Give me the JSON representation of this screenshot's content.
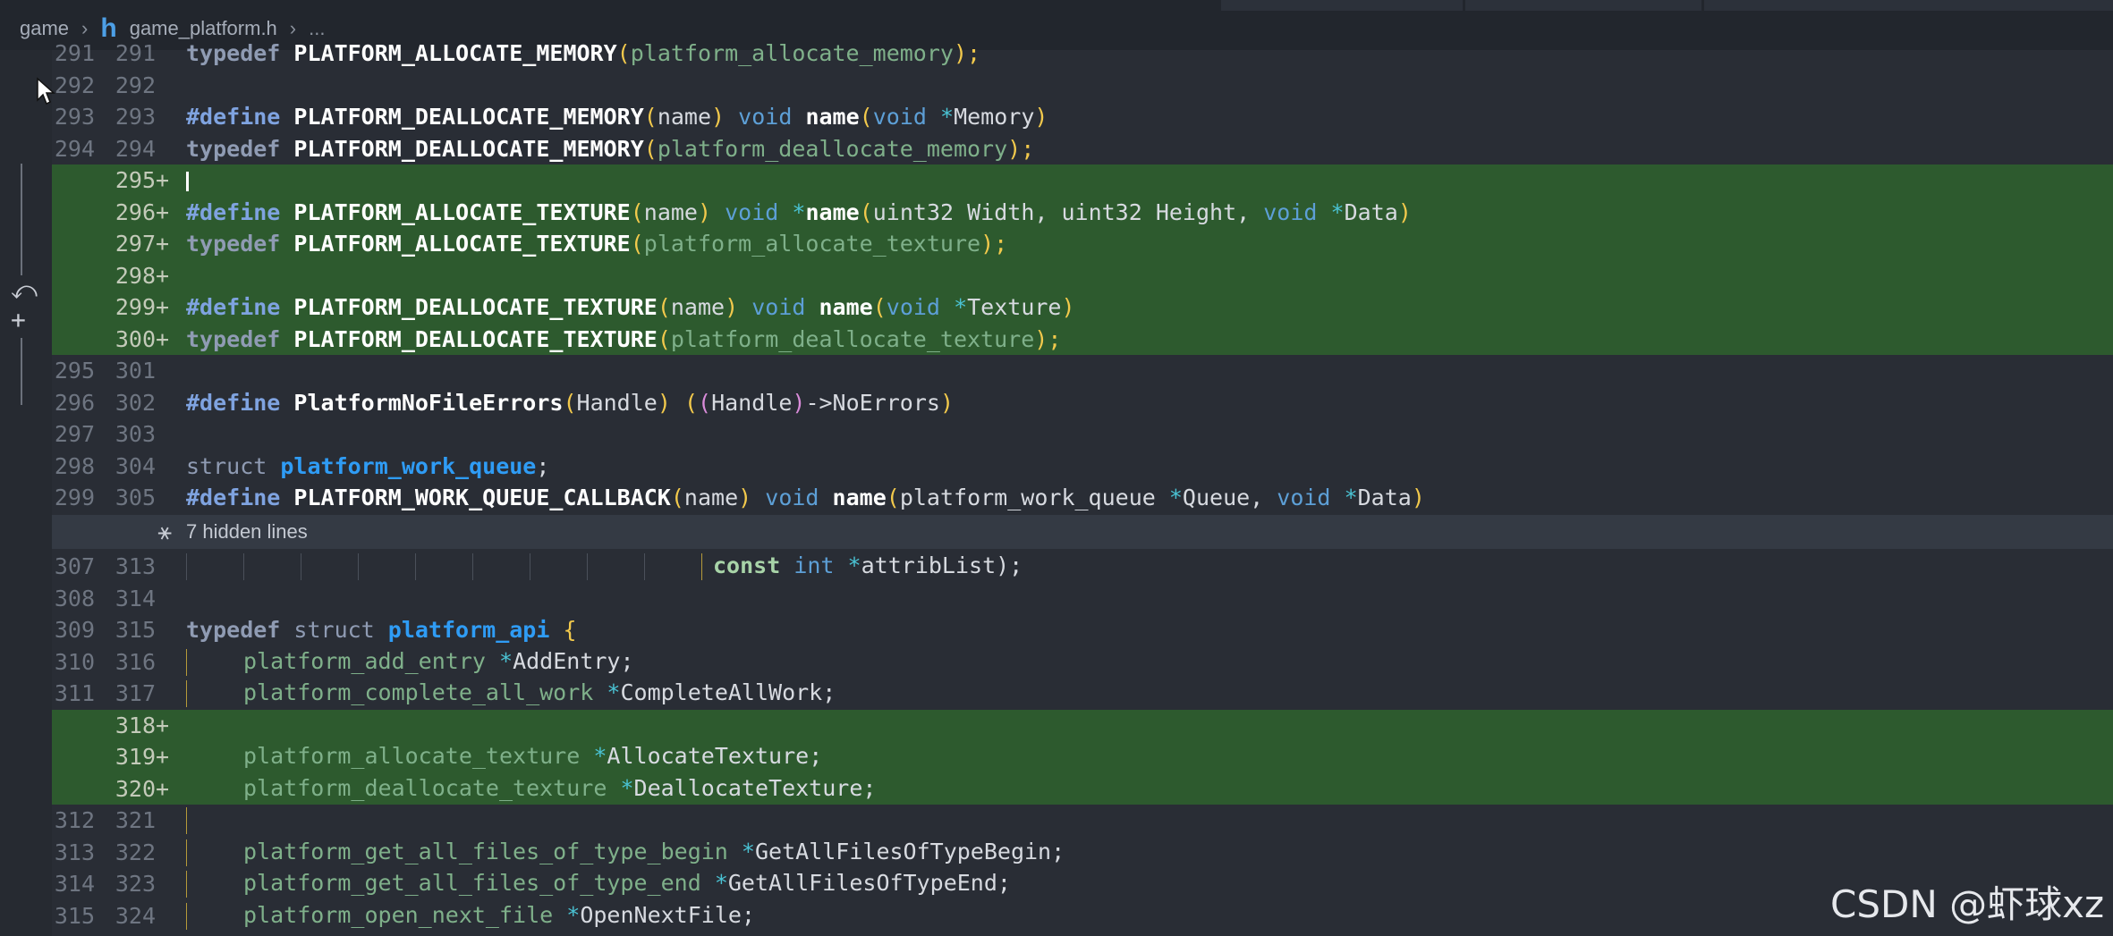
{
  "breadcrumb": {
    "folder": "game",
    "file_icon": "h",
    "file": "game_platform.h",
    "tail": "..."
  },
  "fold": {
    "text": "7 hidden lines"
  },
  "lines": {
    "l291": {
      "old": "291",
      "new": "291",
      "t1": "typedef",
      "t2": "PLATFORM_ALLOCATE_MEMORY",
      "t3": "(",
      "t4": "platform_allocate_memory",
      "t5": ");"
    },
    "l292": {
      "old": "292",
      "new": "292"
    },
    "l293": {
      "old": "293",
      "new": "293",
      "t1": "#define",
      "t2": "PLATFORM_DEALLOCATE_MEMORY",
      "t3": "(",
      "t4": "name",
      "t5": ")",
      "t6": "void",
      "t7": "name",
      "t8": "(",
      "t9": "void",
      "t10": "*",
      "t11": "Memory",
      "t12": ")"
    },
    "l294": {
      "old": "294",
      "new": "294",
      "t1": "typedef",
      "t2": "PLATFORM_DEALLOCATE_MEMORY",
      "t3": "(",
      "t4": "platform_deallocate_memory",
      "t5": ");"
    },
    "a295": {
      "new": "295",
      "mark": "+"
    },
    "a296": {
      "new": "296",
      "mark": "+",
      "t1": "#define",
      "t2": "PLATFORM_ALLOCATE_TEXTURE",
      "t3": "(",
      "t4": "name",
      "t5": ")",
      "t6": "void",
      "t7": "*",
      "t8": "name",
      "t9": "(",
      "t10": "uint32 Width, uint32 Height, ",
      "t11": "void",
      "t12": "*",
      "t13": "Data",
      "t14": ")"
    },
    "a297": {
      "new": "297",
      "mark": "+",
      "t1": "typedef",
      "t2": "PLATFORM_ALLOCATE_TEXTURE",
      "t3": "(",
      "t4": "platform_allocate_texture",
      "t5": ");"
    },
    "a298": {
      "new": "298",
      "mark": "+"
    },
    "a299": {
      "new": "299",
      "mark": "+",
      "t1": "#define",
      "t2": "PLATFORM_DEALLOCATE_TEXTURE",
      "t3": "(",
      "t4": "name",
      "t5": ")",
      "t6": "void",
      "t7": "name",
      "t8": "(",
      "t9": "void",
      "t10": "*",
      "t11": "Texture",
      "t12": ")"
    },
    "a300": {
      "new": "300",
      "mark": "+",
      "t1": "typedef",
      "t2": "PLATFORM_DEALLOCATE_TEXTURE",
      "t3": "(",
      "t4": "platform_deallocate_texture",
      "t5": ");"
    },
    "l301": {
      "old": "295",
      "new": "301"
    },
    "l302": {
      "old": "296",
      "new": "302",
      "t1": "#define",
      "t2": "PlatformNoFileErrors",
      "t3": "(",
      "t4": "Handle",
      "t5": ")",
      "t6": "(",
      "t7": "(",
      "t8": "Handle",
      "t9": ")",
      "t10": "->NoErrors",
      "t11": ")"
    },
    "l303": {
      "old": "297",
      "new": "303"
    },
    "l304": {
      "old": "298",
      "new": "304",
      "t1": "struct",
      "t2": "platform_work_queue",
      "t3": ";"
    },
    "l305": {
      "old": "299",
      "new": "305",
      "t1": "#define",
      "t2": "PLATFORM_WORK_QUEUE_CALLBACK",
      "t3": "(",
      "t4": "name",
      "t5": ")",
      "t6": "void",
      "t7": "name",
      "t8": "(",
      "t9": "platform_work_queue ",
      "t10": "*",
      "t11": "Queue, ",
      "t12": "void",
      "t13": "*",
      "t14": "Data",
      "t15": ")"
    },
    "l313": {
      "old": "307",
      "new": "313",
      "t1": "const",
      "t2": "int",
      "t3": "*",
      "t4": "attribList",
      "t5": ");"
    },
    "l314": {
      "old": "308",
      "new": "314"
    },
    "l315": {
      "old": "309",
      "new": "315",
      "t1": "typedef",
      "t2": "struct",
      "t3": "platform_api",
      "t4": "{"
    },
    "l316": {
      "old": "310",
      "new": "316",
      "t1": "platform_add_entry",
      "t2": "*",
      "t3": "AddEntry;"
    },
    "l317": {
      "old": "311",
      "new": "317",
      "t1": "platform_complete_all_work",
      "t2": "*",
      "t3": "CompleteAllWork;"
    },
    "a318": {
      "new": "318",
      "mark": "+"
    },
    "a319": {
      "new": "319",
      "mark": "+",
      "t1": "platform_allocate_texture",
      "t2": "*",
      "t3": "AllocateTexture;"
    },
    "a320": {
      "new": "320",
      "mark": "+",
      "t1": "platform_deallocate_texture",
      "t2": "*",
      "t3": "DeallocateTexture;"
    },
    "l321": {
      "old": "312",
      "new": "321"
    },
    "l322": {
      "old": "313",
      "new": "322",
      "t1": "platform_get_all_files_of_type_begin",
      "t2": "*",
      "t3": "GetAllFilesOfTypeBegin;"
    },
    "l323": {
      "old": "314",
      "new": "323",
      "t1": "platform_get_all_files_of_type_end",
      "t2": "*",
      "t3": "GetAllFilesOfTypeEnd;"
    },
    "l324": {
      "old": "315",
      "new": "324",
      "t1": "platform_open_next_file",
      "t2": "*",
      "t3": "OpenNextFile;"
    }
  },
  "watermark": "CSDN @虾球xz",
  "colors": {
    "background": "#292d35",
    "added_line": "#2d5a2e",
    "fold_row": "#343a44",
    "struct_name": "#2f9cf5",
    "paren": "#f2c94c"
  },
  "icons": {
    "cursor": "mouse-pointer-icon",
    "revert": "revert-icon",
    "add": "plus-icon",
    "fold": "expand-icon",
    "file": "h-file-icon"
  }
}
